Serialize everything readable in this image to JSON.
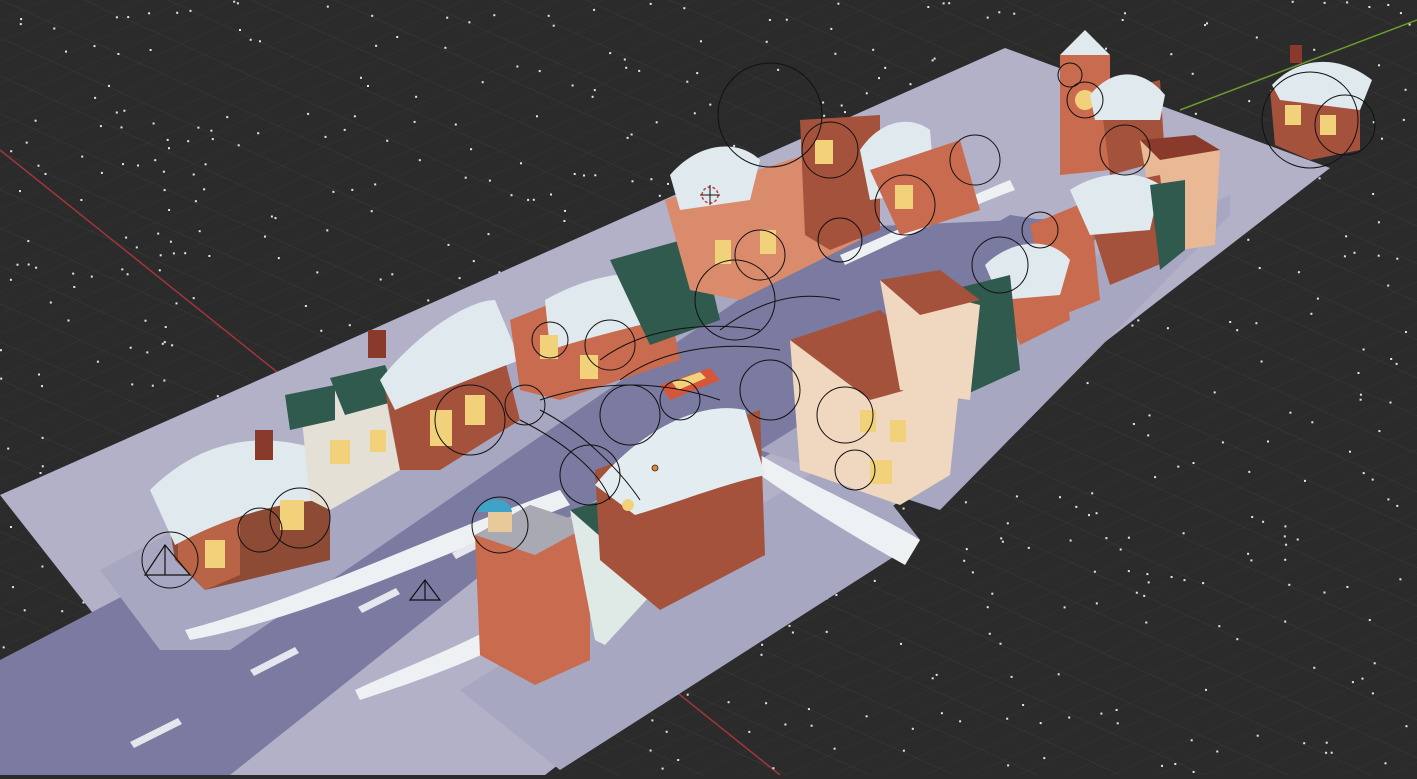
{
  "app": {
    "name": "",
    "view": "3D Viewport"
  },
  "scene": {
    "description_note": "",
    "colors": {
      "background": "#2b2b2b",
      "grid_line": "#3b3b3b",
      "grid_major": "#454545",
      "x_axis": "#a0363b",
      "y_axis": "#6b9a2e",
      "ground": "#b4b3c9",
      "road": "#7c7ba1",
      "sidewalk": "#a3a2bd",
      "snow": "#e9ecef",
      "brick": "#c56048",
      "dark_green": "#2f5a4d",
      "cream": "#efd7c0",
      "window_glow": "#f3d37a",
      "roof_snow": "#dfeaee",
      "dome": "#3ea3c6",
      "gizmo": "#111111"
    },
    "objects": [
      {
        "type": "house",
        "name": ""
      }
    ]
  }
}
